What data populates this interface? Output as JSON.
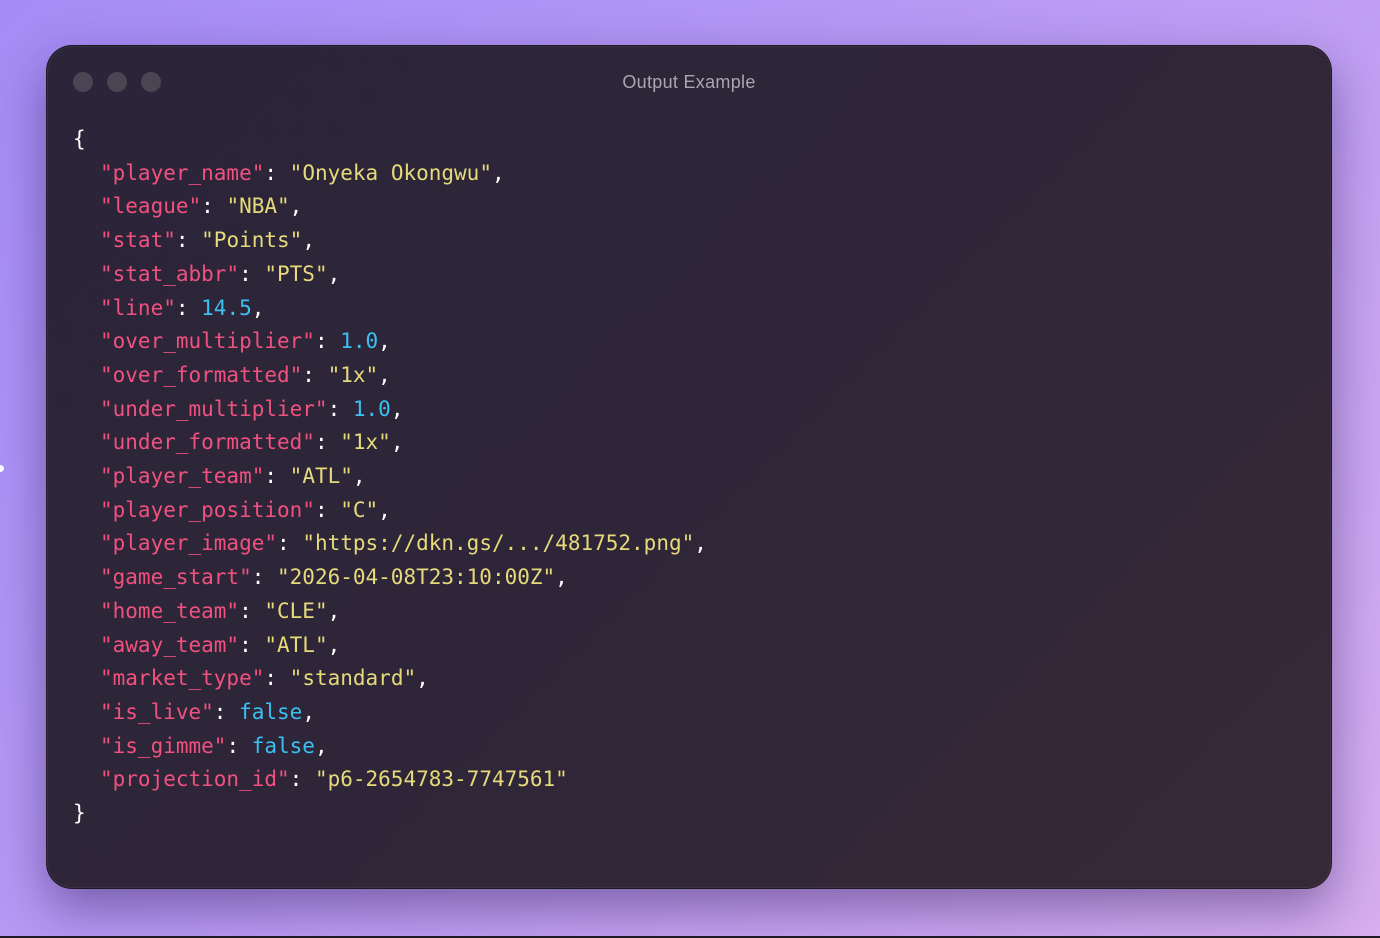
{
  "window": {
    "title": "Output Example"
  },
  "code": {
    "open_brace": "{",
    "close_brace": "}",
    "lines": [
      {
        "key": "\"player_name\"",
        "value": "\"Onyeka Okongwu\"",
        "type": "string",
        "comma": true
      },
      {
        "key": "\"league\"",
        "value": "\"NBA\"",
        "type": "string",
        "comma": true
      },
      {
        "key": "\"stat\"",
        "value": "\"Points\"",
        "type": "string",
        "comma": true
      },
      {
        "key": "\"stat_abbr\"",
        "value": "\"PTS\"",
        "type": "string",
        "comma": true
      },
      {
        "key": "\"line\"",
        "value": "14.5",
        "type": "number",
        "comma": true
      },
      {
        "key": "\"over_multiplier\"",
        "value": "1.0",
        "type": "number",
        "comma": true
      },
      {
        "key": "\"over_formatted\"",
        "value": "\"1x\"",
        "type": "string",
        "comma": true
      },
      {
        "key": "\"under_multiplier\"",
        "value": "1.0",
        "type": "number",
        "comma": true
      },
      {
        "key": "\"under_formatted\"",
        "value": "\"1x\"",
        "type": "string",
        "comma": true
      },
      {
        "key": "\"player_team\"",
        "value": "\"ATL\"",
        "type": "string",
        "comma": true
      },
      {
        "key": "\"player_position\"",
        "value": "\"C\"",
        "type": "string",
        "comma": true
      },
      {
        "key": "\"player_image\"",
        "value": "\"https://dkn.gs/.../481752.png\"",
        "type": "string",
        "comma": true
      },
      {
        "key": "\"game_start\"",
        "value": "\"2026-04-08T23:10:00Z\"",
        "type": "string",
        "comma": true
      },
      {
        "key": "\"home_team\"",
        "value": "\"CLE\"",
        "type": "string",
        "comma": true
      },
      {
        "key": "\"away_team\"",
        "value": "\"ATL\"",
        "type": "string",
        "comma": true
      },
      {
        "key": "\"market_type\"",
        "value": "\"standard\"",
        "type": "string",
        "comma": true
      },
      {
        "key": "\"is_live\"",
        "value": "false",
        "type": "number",
        "comma": true
      },
      {
        "key": "\"is_gimme\"",
        "value": "false",
        "type": "number",
        "comma": true
      },
      {
        "key": "\"projection_id\"",
        "value": "\"p6-2654783-7747561\"",
        "type": "string",
        "comma": false
      }
    ]
  },
  "colors": {
    "key": "#f1517f",
    "string": "#e6da7b",
    "number": "#3bc0f2",
    "punctuation": "#ffffff"
  }
}
